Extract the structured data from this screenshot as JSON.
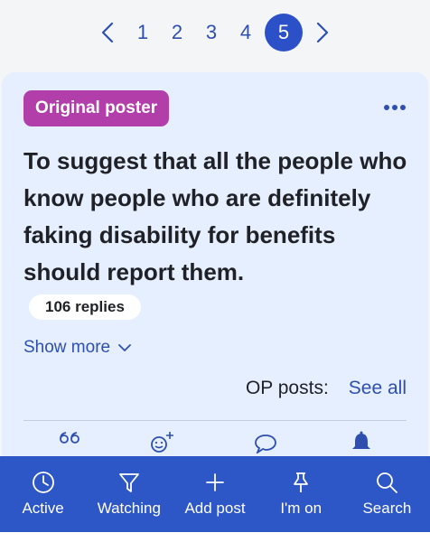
{
  "pagination": {
    "pages": [
      "1",
      "2",
      "3",
      "4",
      "5"
    ],
    "current": "5"
  },
  "post": {
    "badge": "Original poster",
    "title": "To suggest that all the people who know people who are definitely faking disability for benefits should report them.",
    "replies": "106 replies",
    "show_more": "Show more",
    "op_posts_label": "OP posts:",
    "see_all": "See all"
  },
  "tabbar": {
    "items": [
      {
        "label": "Active",
        "icon": "clock-icon"
      },
      {
        "label": "Watching",
        "icon": "watching-icon"
      },
      {
        "label": "Add post",
        "icon": "plus-icon"
      },
      {
        "label": "I'm on",
        "icon": "pin-icon"
      },
      {
        "label": "Search",
        "icon": "search-icon"
      }
    ]
  },
  "colors": {
    "accent": "#2d56c6",
    "badge": "#b23fa9",
    "card": "#e5efff",
    "link": "#2f4fb0"
  }
}
